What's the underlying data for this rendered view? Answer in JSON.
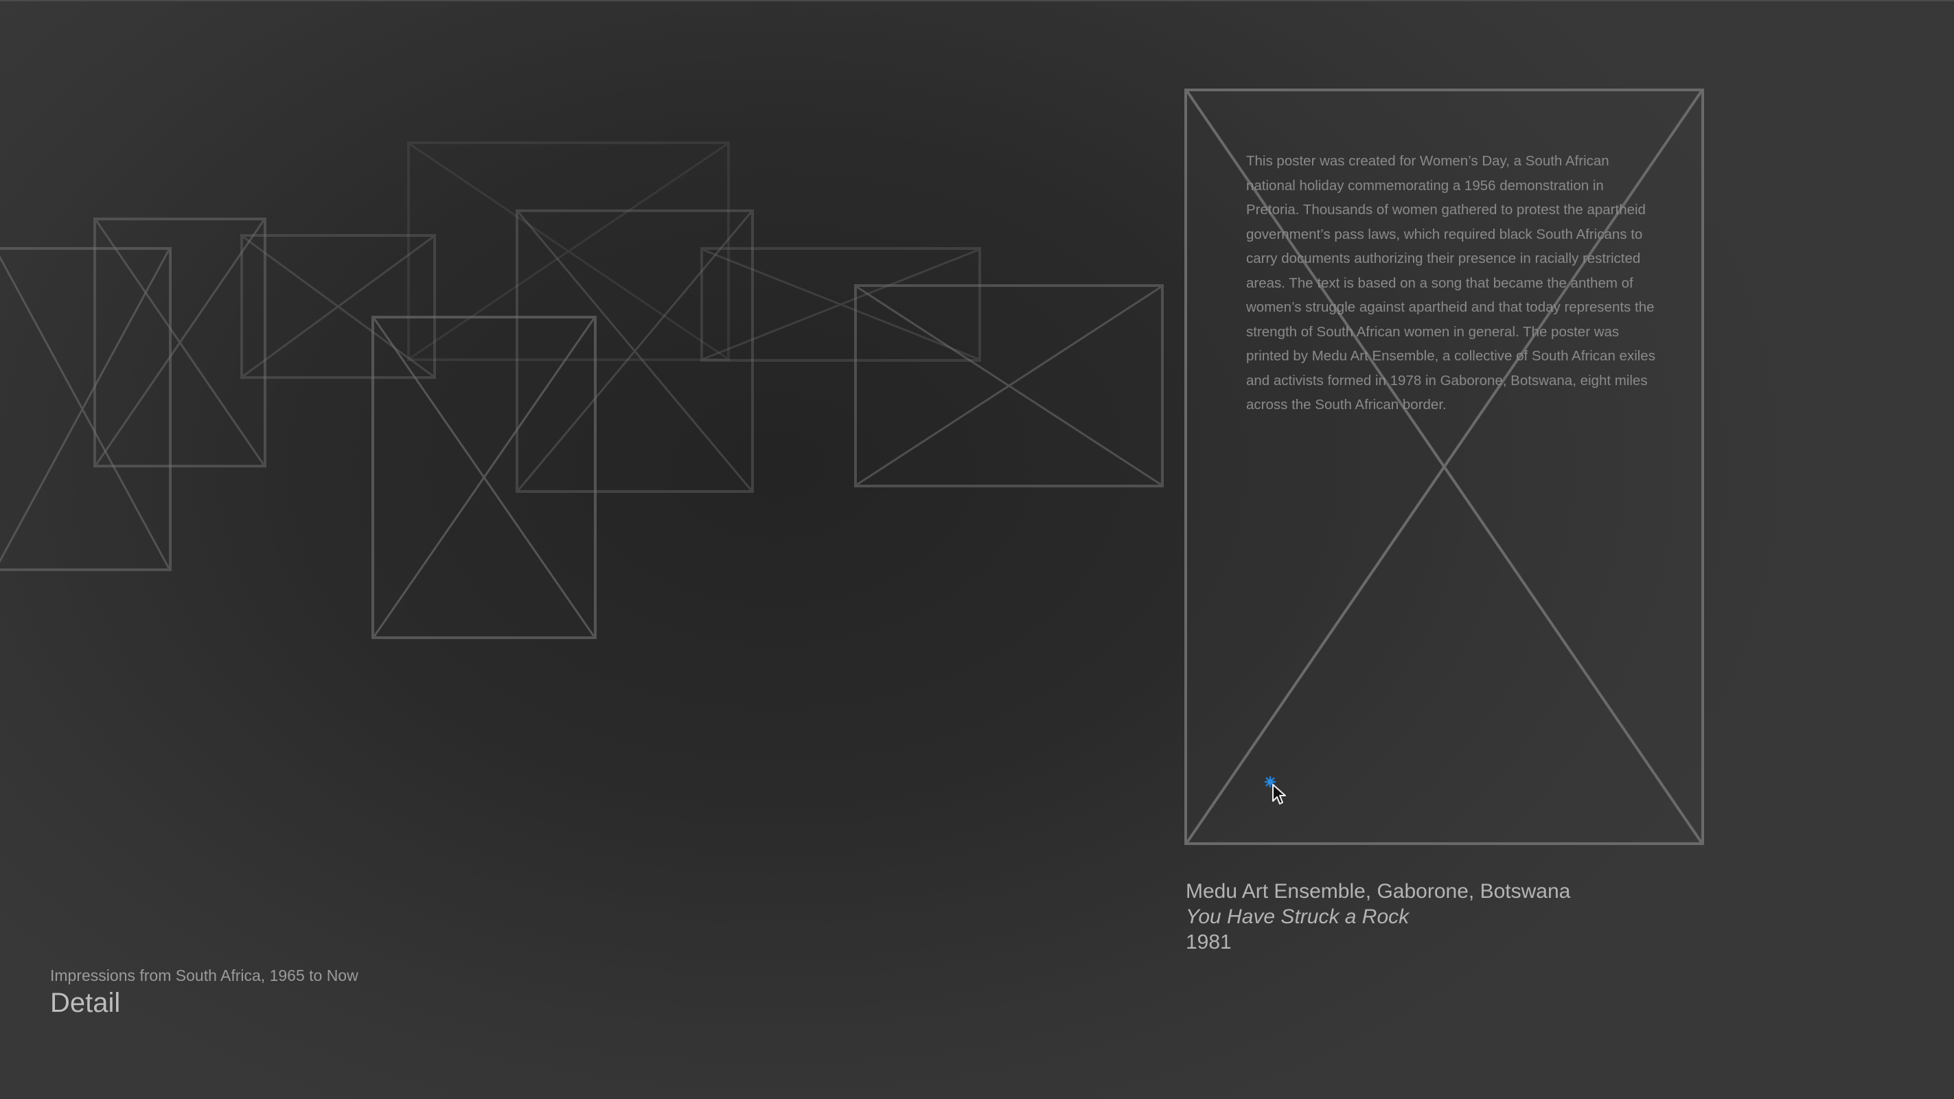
{
  "poster": {
    "description": "This poster was created for Women’s Day, a South African national holiday commemorating a 1956 demonstration in Pretoria. Thousands of women gathered to protest the apartheid government’s pass laws, which required black South Africans to carry documents authorizing their presence in racially restricted areas. The text is based on a song that became the anthem of women’s struggle against apartheid and that today represents the strength of South African women in general. The poster was printed by Medu Art Ensemble, a collective of South African exiles and activists formed in 1978 in Gaborone, Botswana, eight miles across the South African border.",
    "artist": "Medu Art Ensemble, Gaborone, Botswana",
    "title": "You Have Struck a Rock",
    "year": "1981"
  },
  "footer": {
    "exhibition": "Impressions from South Africa, 1965 to Now",
    "view": "Detail"
  },
  "colors": {
    "background": "#2a2a2a",
    "placeholder_stroke": "#707070",
    "cursor_highlight": "#1e7fd6"
  },
  "icons": {
    "cursor": "arrow-pointer-icon"
  }
}
